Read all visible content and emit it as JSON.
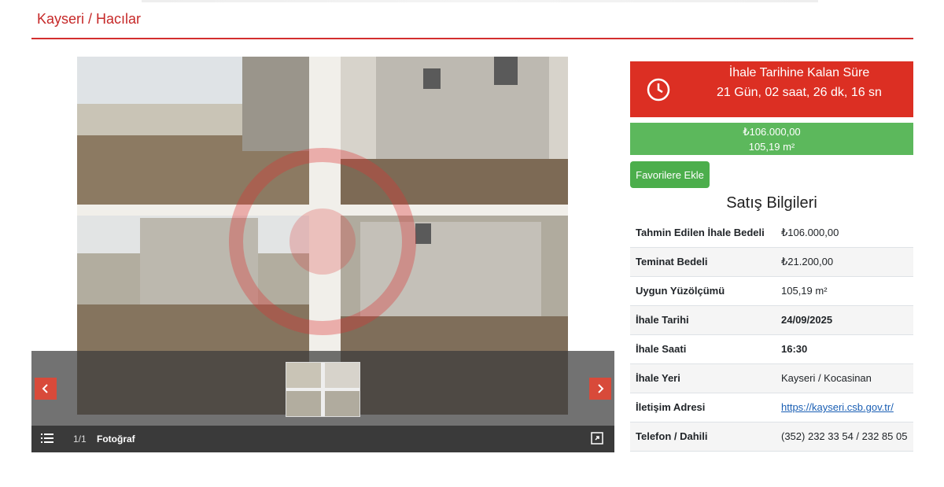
{
  "breadcrumb": "Kayseri / Hacılar",
  "gallery": {
    "counter": "1/1",
    "label": "Fotoğraf",
    "image_description": "photo-collage"
  },
  "countdown": {
    "title": "İhale Tarihine Kalan Süre",
    "value": "21 Gün, 02 saat, 26 dk, 16 sn"
  },
  "price": {
    "amount": "₺106.000,00",
    "area": "105,19 m²"
  },
  "favorite_button": "Favorilere Ekle",
  "sales_info": {
    "title": "Satış Bilgileri",
    "rows": [
      {
        "label": "Tahmin Edilen İhale Bedeli",
        "value": "₺106.000,00"
      },
      {
        "label": "Teminat Bedeli",
        "value": "₺21.200,00"
      },
      {
        "label": "Uygun Yüzölçümü",
        "value": "105,19 m²"
      },
      {
        "label": "İhale Tarihi",
        "value": "24/09/2025"
      },
      {
        "label": "İhale Saati",
        "value": "16:30"
      },
      {
        "label": "İhale Yeri",
        "value": "Kayseri / Kocasinan"
      },
      {
        "label": "İletişim Adresi",
        "value": "https://kayseri.csb.gov.tr/"
      },
      {
        "label": "Telefon / Dahili",
        "value": "(352) 232 33 54 / 232 85 05"
      }
    ]
  },
  "colors": {
    "accent_red": "#dc2f23",
    "success_green": "#5cb85c",
    "link_blue": "#1a5fb4"
  }
}
